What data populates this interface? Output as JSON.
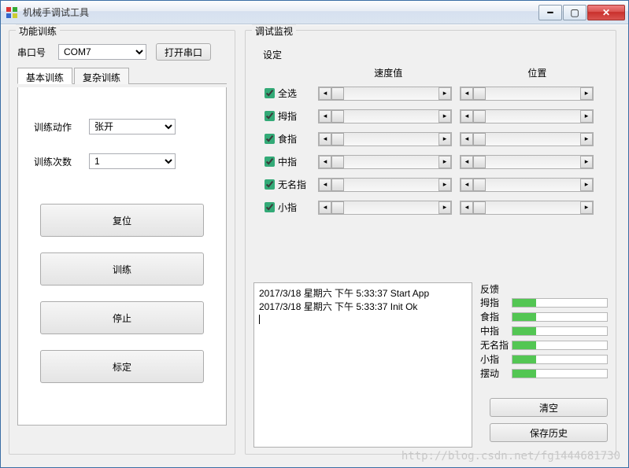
{
  "window": {
    "title": "机械手调试工具"
  },
  "left": {
    "group_title": "功能训练",
    "port_label": "串口号",
    "port_value": "COM7",
    "open_port_btn": "打开串口",
    "tabs": {
      "basic": "基本训练",
      "complex": "复杂训练"
    },
    "action_label": "训练动作",
    "action_value": "张开",
    "count_label": "训练次数",
    "count_value": "1",
    "btn_reset": "复位",
    "btn_train": "训练",
    "btn_stop": "停止",
    "btn_calib": "标定"
  },
  "right": {
    "group_title": "调试监视",
    "settings_label": "设定",
    "col_speed": "速度值",
    "col_pos": "位置",
    "rows": [
      {
        "label": "全选",
        "checked": true
      },
      {
        "label": "拇指",
        "checked": true
      },
      {
        "label": "食指",
        "checked": true
      },
      {
        "label": "中指",
        "checked": true
      },
      {
        "label": "无名指",
        "checked": true
      },
      {
        "label": "小指",
        "checked": true
      }
    ],
    "log": "2017/3/18 星期六 下午 5:33:37 Start App\n2017/3/18 星期六 下午 5:33:37 Init Ok",
    "feedback_title": "反馈",
    "feedback": [
      {
        "label": "拇指",
        "pct": 25
      },
      {
        "label": "食指",
        "pct": 25
      },
      {
        "label": "中指",
        "pct": 25
      },
      {
        "label": "无名指",
        "pct": 25
      },
      {
        "label": "小指",
        "pct": 25
      },
      {
        "label": "摆动",
        "pct": 25
      }
    ],
    "btn_clear": "清空",
    "btn_save": "保存历史"
  },
  "watermark": "http://blog.csdn.net/fg1444681730"
}
